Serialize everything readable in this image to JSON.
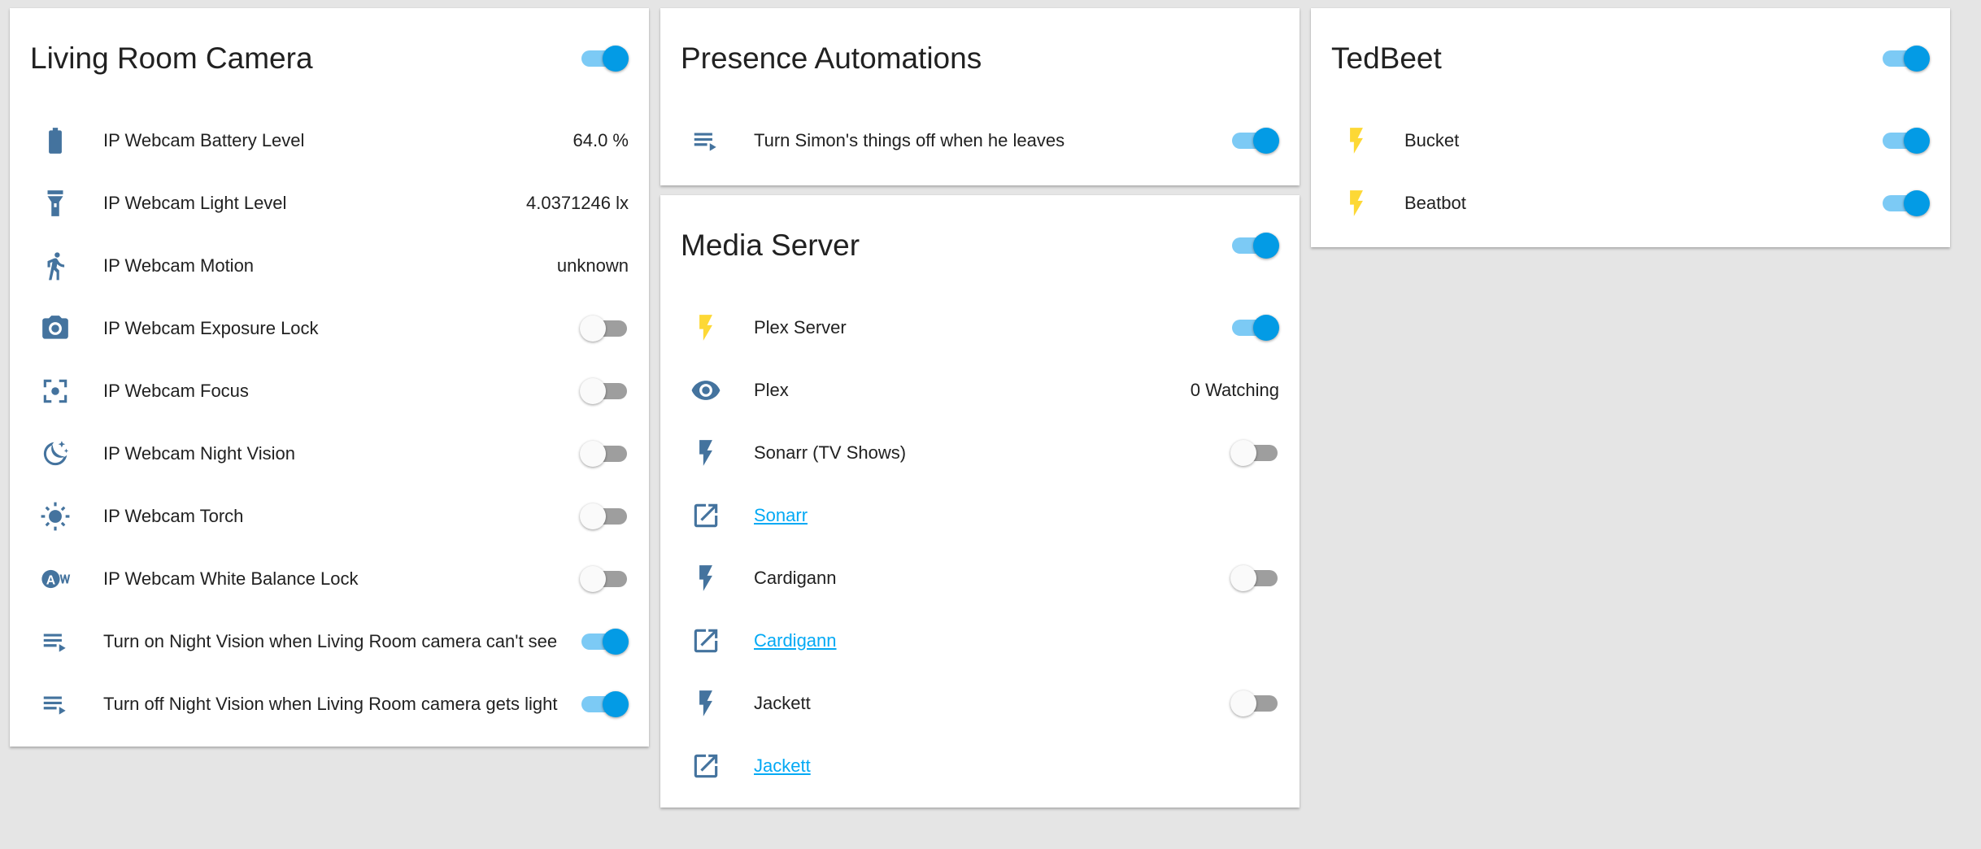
{
  "living_room": {
    "title": "Living Room Camera",
    "header_toggle": true,
    "rows": [
      {
        "icon": "battery-icon",
        "label": "IP Webcam Battery Level",
        "value": "64.0 %"
      },
      {
        "icon": "flashlight-icon",
        "label": "IP Webcam Light Level",
        "value": "4.0371246 lx"
      },
      {
        "icon": "run-icon",
        "label": "IP Webcam Motion",
        "value": "unknown"
      },
      {
        "icon": "camera-icon",
        "label": "IP Webcam Exposure Lock",
        "toggle": false
      },
      {
        "icon": "focus-icon",
        "label": "IP Webcam Focus",
        "toggle": false
      },
      {
        "icon": "moon-icon",
        "label": "IP Webcam Night Vision",
        "toggle": false
      },
      {
        "icon": "brightness-icon",
        "label": "IP Webcam Torch",
        "toggle": false
      },
      {
        "icon": "white-balance-icon",
        "label": "IP Webcam White Balance Lock",
        "toggle": false
      },
      {
        "icon": "playlist-play-icon",
        "label": "Turn on Night Vision when Living Room camera can't see",
        "toggle": true
      },
      {
        "icon": "playlist-play-icon",
        "label": "Turn off Night Vision when Living Room camera gets light",
        "toggle": true
      }
    ]
  },
  "presence": {
    "title": "Presence Automations",
    "rows": [
      {
        "icon": "playlist-play-icon",
        "label": "Turn Simon's things off when he leaves",
        "toggle": true
      }
    ]
  },
  "media": {
    "title": "Media Server",
    "header_toggle": true,
    "rows": [
      {
        "icon": "flash-icon",
        "yellow": true,
        "label": "Plex Server",
        "toggle": true
      },
      {
        "icon": "eye-icon",
        "label": "Plex",
        "value": "0 Watching"
      },
      {
        "icon": "flash-icon",
        "label": "Sonarr (TV Shows)",
        "toggle": false
      },
      {
        "icon": "open-in-new-icon",
        "label": "Sonarr",
        "link": true
      },
      {
        "icon": "flash-icon",
        "label": "Cardigann",
        "toggle": false
      },
      {
        "icon": "open-in-new-icon",
        "label": "Cardigann",
        "link": true
      },
      {
        "icon": "flash-icon",
        "label": "Jackett",
        "toggle": false
      },
      {
        "icon": "open-in-new-icon",
        "label": "Jackett",
        "link": true
      }
    ]
  },
  "tedbeet": {
    "title": "TedBeet",
    "header_toggle": true,
    "rows": [
      {
        "icon": "flash-icon",
        "yellow": true,
        "label": "Bucket",
        "toggle": true
      },
      {
        "icon": "flash-icon",
        "yellow": true,
        "label": "Beatbot",
        "toggle": true
      }
    ]
  }
}
